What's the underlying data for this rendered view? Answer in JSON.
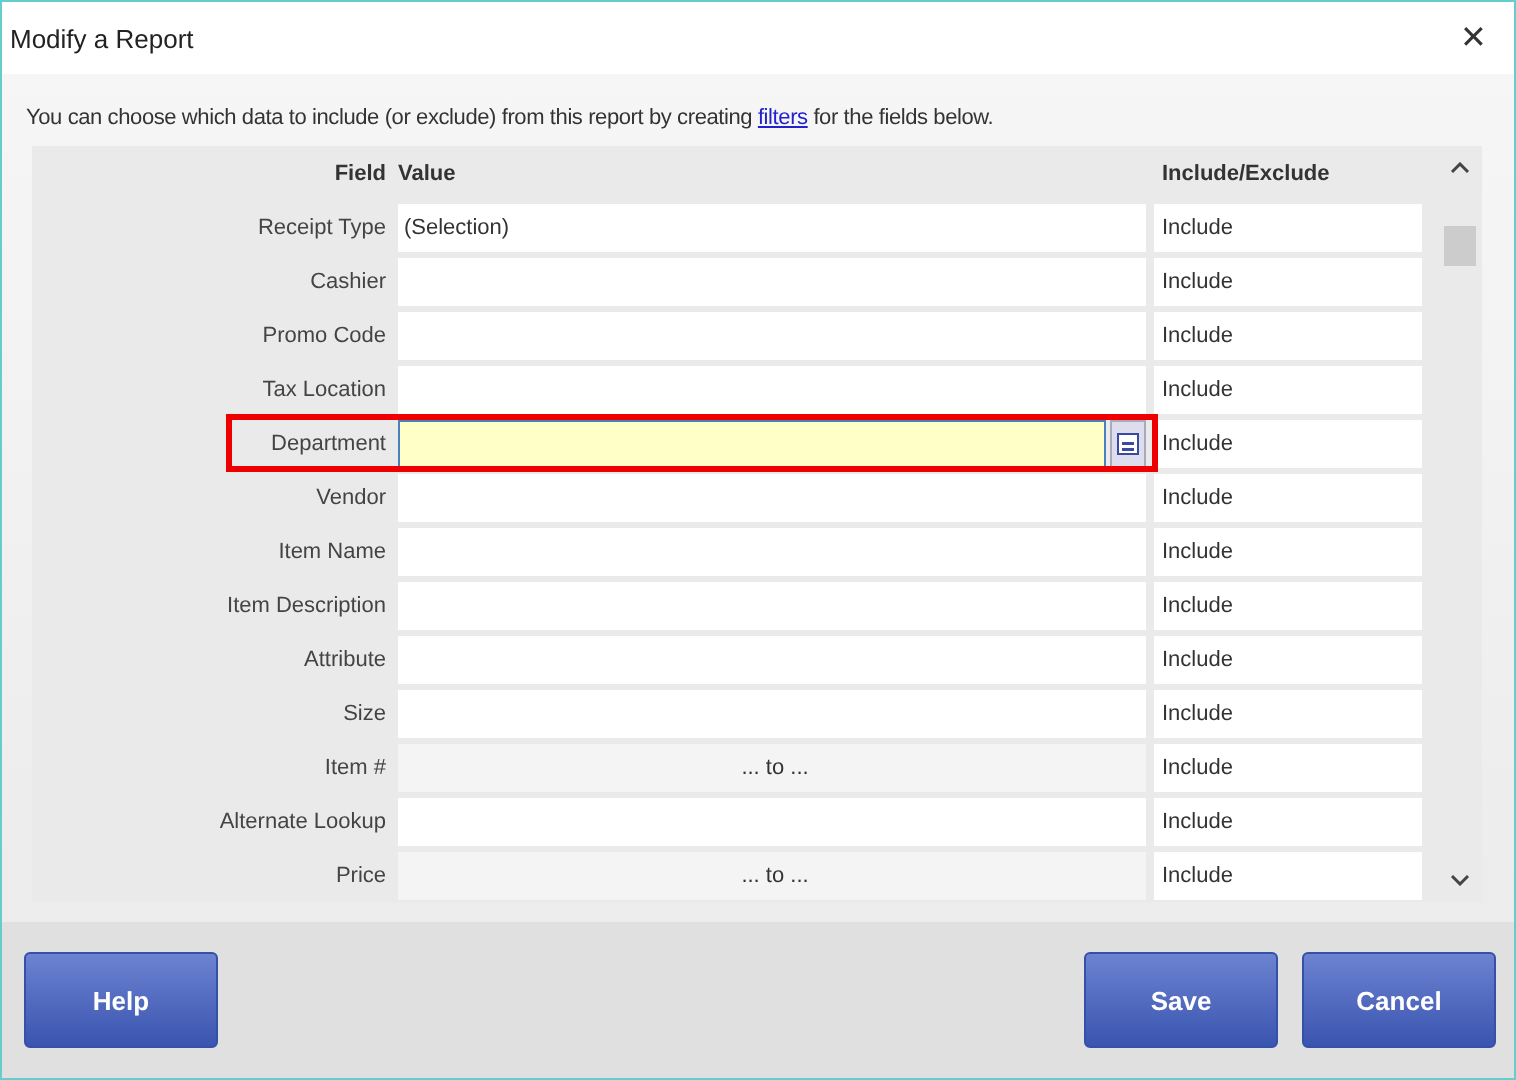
{
  "window": {
    "title": "Modify a Report",
    "close": "✕"
  },
  "intro": {
    "before": "You can choose which data to include (or exclude) from this report by creating",
    "link": "filters",
    "after": "for the fields below."
  },
  "table": {
    "columns": [
      "Field",
      "Value",
      "Include/Exclude"
    ],
    "rows": [
      {
        "field": "Receipt Type",
        "kind": "text",
        "value": "(Selection)",
        "include": "Include",
        "selected": false
      },
      {
        "field": "Cashier",
        "kind": "text",
        "value": "",
        "include": "Include",
        "selected": false
      },
      {
        "field": "Promo Code",
        "kind": "text",
        "value": "",
        "include": "Include",
        "selected": false
      },
      {
        "field": "Tax Location",
        "kind": "text",
        "value": "",
        "include": "Include",
        "selected": false
      },
      {
        "field": "Department",
        "kind": "text",
        "value": "",
        "include": "Include",
        "selected": true
      },
      {
        "field": "Vendor",
        "kind": "text",
        "value": "",
        "include": "Include",
        "selected": false
      },
      {
        "field": "Item Name",
        "kind": "text",
        "value": "",
        "include": "Include",
        "selected": false
      },
      {
        "field": "Item Description",
        "kind": "text",
        "value": "",
        "include": "Include",
        "selected": false
      },
      {
        "field": "Attribute",
        "kind": "text",
        "value": "",
        "include": "Include",
        "selected": false
      },
      {
        "field": "Size",
        "kind": "text",
        "value": "",
        "include": "Include",
        "selected": false
      },
      {
        "field": "Item #",
        "kind": "range",
        "value": "... to ...",
        "include": "Include",
        "selected": false
      },
      {
        "field": "Alternate Lookup",
        "kind": "text",
        "value": "",
        "include": "Include",
        "selected": false
      },
      {
        "field": "Price",
        "kind": "range",
        "value": "... to ...",
        "include": "Include",
        "selected": false
      }
    ]
  },
  "buttons": [
    {
      "label": "Help",
      "kind": "help"
    },
    {
      "label": "Save",
      "kind": "save"
    },
    {
      "label": "Cancel",
      "kind": "cancel"
    }
  ]
}
